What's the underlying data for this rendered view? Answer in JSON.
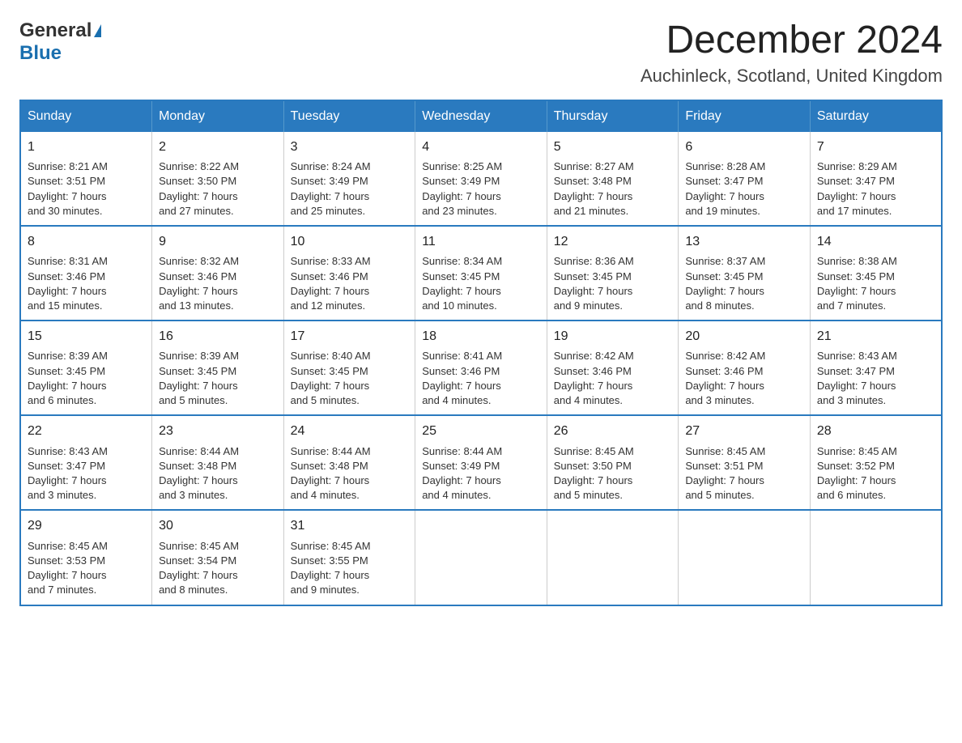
{
  "header": {
    "logo_general": "General",
    "logo_blue": "Blue",
    "title": "December 2024",
    "subtitle": "Auchinleck, Scotland, United Kingdom"
  },
  "weekdays": [
    "Sunday",
    "Monday",
    "Tuesday",
    "Wednesday",
    "Thursday",
    "Friday",
    "Saturday"
  ],
  "weeks": [
    [
      {
        "day": "1",
        "sunrise": "Sunrise: 8:21 AM",
        "sunset": "Sunset: 3:51 PM",
        "daylight": "Daylight: 7 hours",
        "daylight2": "and 30 minutes."
      },
      {
        "day": "2",
        "sunrise": "Sunrise: 8:22 AM",
        "sunset": "Sunset: 3:50 PM",
        "daylight": "Daylight: 7 hours",
        "daylight2": "and 27 minutes."
      },
      {
        "day": "3",
        "sunrise": "Sunrise: 8:24 AM",
        "sunset": "Sunset: 3:49 PM",
        "daylight": "Daylight: 7 hours",
        "daylight2": "and 25 minutes."
      },
      {
        "day": "4",
        "sunrise": "Sunrise: 8:25 AM",
        "sunset": "Sunset: 3:49 PM",
        "daylight": "Daylight: 7 hours",
        "daylight2": "and 23 minutes."
      },
      {
        "day": "5",
        "sunrise": "Sunrise: 8:27 AM",
        "sunset": "Sunset: 3:48 PM",
        "daylight": "Daylight: 7 hours",
        "daylight2": "and 21 minutes."
      },
      {
        "day": "6",
        "sunrise": "Sunrise: 8:28 AM",
        "sunset": "Sunset: 3:47 PM",
        "daylight": "Daylight: 7 hours",
        "daylight2": "and 19 minutes."
      },
      {
        "day": "7",
        "sunrise": "Sunrise: 8:29 AM",
        "sunset": "Sunset: 3:47 PM",
        "daylight": "Daylight: 7 hours",
        "daylight2": "and 17 minutes."
      }
    ],
    [
      {
        "day": "8",
        "sunrise": "Sunrise: 8:31 AM",
        "sunset": "Sunset: 3:46 PM",
        "daylight": "Daylight: 7 hours",
        "daylight2": "and 15 minutes."
      },
      {
        "day": "9",
        "sunrise": "Sunrise: 8:32 AM",
        "sunset": "Sunset: 3:46 PM",
        "daylight": "Daylight: 7 hours",
        "daylight2": "and 13 minutes."
      },
      {
        "day": "10",
        "sunrise": "Sunrise: 8:33 AM",
        "sunset": "Sunset: 3:46 PM",
        "daylight": "Daylight: 7 hours",
        "daylight2": "and 12 minutes."
      },
      {
        "day": "11",
        "sunrise": "Sunrise: 8:34 AM",
        "sunset": "Sunset: 3:45 PM",
        "daylight": "Daylight: 7 hours",
        "daylight2": "and 10 minutes."
      },
      {
        "day": "12",
        "sunrise": "Sunrise: 8:36 AM",
        "sunset": "Sunset: 3:45 PM",
        "daylight": "Daylight: 7 hours",
        "daylight2": "and 9 minutes."
      },
      {
        "day": "13",
        "sunrise": "Sunrise: 8:37 AM",
        "sunset": "Sunset: 3:45 PM",
        "daylight": "Daylight: 7 hours",
        "daylight2": "and 8 minutes."
      },
      {
        "day": "14",
        "sunrise": "Sunrise: 8:38 AM",
        "sunset": "Sunset: 3:45 PM",
        "daylight": "Daylight: 7 hours",
        "daylight2": "and 7 minutes."
      }
    ],
    [
      {
        "day": "15",
        "sunrise": "Sunrise: 8:39 AM",
        "sunset": "Sunset: 3:45 PM",
        "daylight": "Daylight: 7 hours",
        "daylight2": "and 6 minutes."
      },
      {
        "day": "16",
        "sunrise": "Sunrise: 8:39 AM",
        "sunset": "Sunset: 3:45 PM",
        "daylight": "Daylight: 7 hours",
        "daylight2": "and 5 minutes."
      },
      {
        "day": "17",
        "sunrise": "Sunrise: 8:40 AM",
        "sunset": "Sunset: 3:45 PM",
        "daylight": "Daylight: 7 hours",
        "daylight2": "and 5 minutes."
      },
      {
        "day": "18",
        "sunrise": "Sunrise: 8:41 AM",
        "sunset": "Sunset: 3:46 PM",
        "daylight": "Daylight: 7 hours",
        "daylight2": "and 4 minutes."
      },
      {
        "day": "19",
        "sunrise": "Sunrise: 8:42 AM",
        "sunset": "Sunset: 3:46 PM",
        "daylight": "Daylight: 7 hours",
        "daylight2": "and 4 minutes."
      },
      {
        "day": "20",
        "sunrise": "Sunrise: 8:42 AM",
        "sunset": "Sunset: 3:46 PM",
        "daylight": "Daylight: 7 hours",
        "daylight2": "and 3 minutes."
      },
      {
        "day": "21",
        "sunrise": "Sunrise: 8:43 AM",
        "sunset": "Sunset: 3:47 PM",
        "daylight": "Daylight: 7 hours",
        "daylight2": "and 3 minutes."
      }
    ],
    [
      {
        "day": "22",
        "sunrise": "Sunrise: 8:43 AM",
        "sunset": "Sunset: 3:47 PM",
        "daylight": "Daylight: 7 hours",
        "daylight2": "and 3 minutes."
      },
      {
        "day": "23",
        "sunrise": "Sunrise: 8:44 AM",
        "sunset": "Sunset: 3:48 PM",
        "daylight": "Daylight: 7 hours",
        "daylight2": "and 3 minutes."
      },
      {
        "day": "24",
        "sunrise": "Sunrise: 8:44 AM",
        "sunset": "Sunset: 3:48 PM",
        "daylight": "Daylight: 7 hours",
        "daylight2": "and 4 minutes."
      },
      {
        "day": "25",
        "sunrise": "Sunrise: 8:44 AM",
        "sunset": "Sunset: 3:49 PM",
        "daylight": "Daylight: 7 hours",
        "daylight2": "and 4 minutes."
      },
      {
        "day": "26",
        "sunrise": "Sunrise: 8:45 AM",
        "sunset": "Sunset: 3:50 PM",
        "daylight": "Daylight: 7 hours",
        "daylight2": "and 5 minutes."
      },
      {
        "day": "27",
        "sunrise": "Sunrise: 8:45 AM",
        "sunset": "Sunset: 3:51 PM",
        "daylight": "Daylight: 7 hours",
        "daylight2": "and 5 minutes."
      },
      {
        "day": "28",
        "sunrise": "Sunrise: 8:45 AM",
        "sunset": "Sunset: 3:52 PM",
        "daylight": "Daylight: 7 hours",
        "daylight2": "and 6 minutes."
      }
    ],
    [
      {
        "day": "29",
        "sunrise": "Sunrise: 8:45 AM",
        "sunset": "Sunset: 3:53 PM",
        "daylight": "Daylight: 7 hours",
        "daylight2": "and 7 minutes."
      },
      {
        "day": "30",
        "sunrise": "Sunrise: 8:45 AM",
        "sunset": "Sunset: 3:54 PM",
        "daylight": "Daylight: 7 hours",
        "daylight2": "and 8 minutes."
      },
      {
        "day": "31",
        "sunrise": "Sunrise: 8:45 AM",
        "sunset": "Sunset: 3:55 PM",
        "daylight": "Daylight: 7 hours",
        "daylight2": "and 9 minutes."
      },
      null,
      null,
      null,
      null
    ]
  ]
}
